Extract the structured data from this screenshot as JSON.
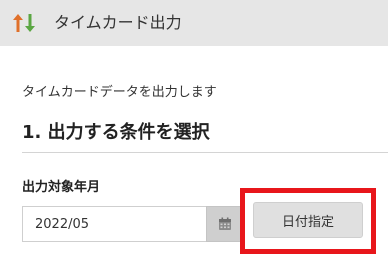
{
  "header": {
    "title": "タイムカード出力",
    "icon": "sort-arrows-icon",
    "icon_colors": {
      "up_arrow": "#e0702a",
      "down_arrow": "#5aa642"
    }
  },
  "main": {
    "description": "タイムカードデータを出力します",
    "section_heading": "1. 出力する条件を選択",
    "field_label": "出力対象年月",
    "date_input": {
      "value": "2022/05",
      "placeholder": ""
    },
    "calendar_button_icon": "calendar-icon",
    "date_specify_button_label": "日付指定",
    "highlight_color": "#e8161b"
  }
}
